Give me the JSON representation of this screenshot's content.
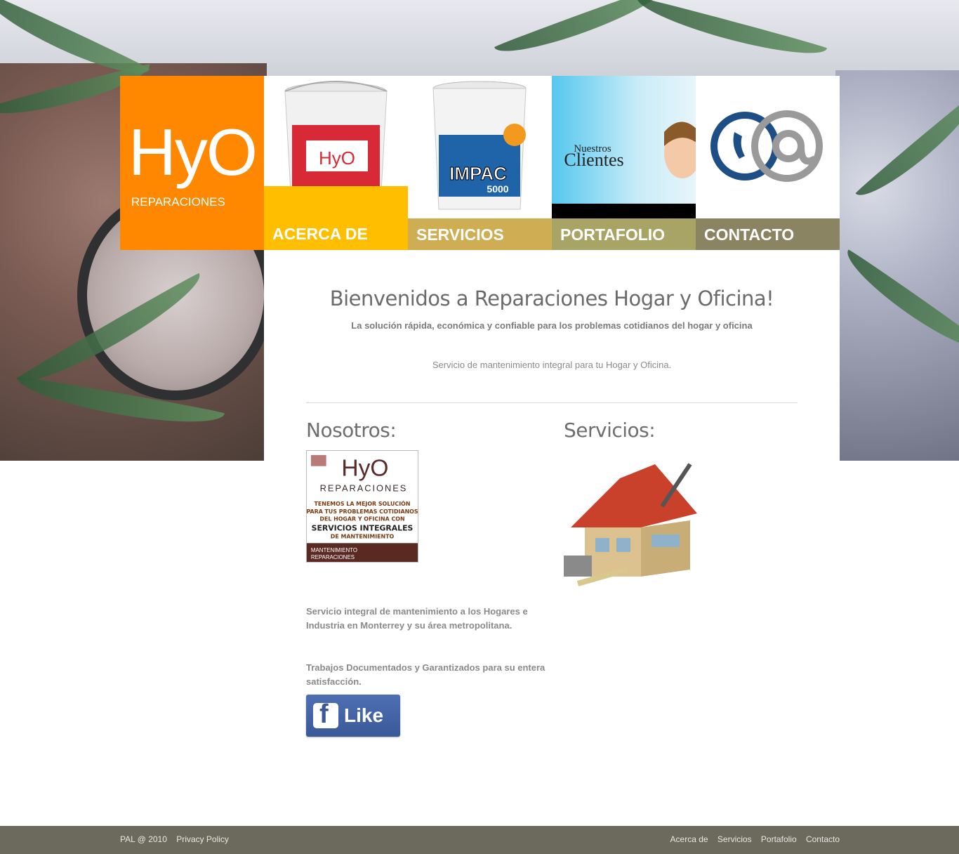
{
  "logo": {
    "title": "HyO",
    "subtitle": "REPARACIONES"
  },
  "nav": [
    {
      "label": "ACERCA DE"
    },
    {
      "label": "SERVICIOS"
    },
    {
      "label": "PORTAFOLIO"
    },
    {
      "label": "CONTACTO"
    }
  ],
  "tiles": {
    "bucket1": {
      "brand": "HyO"
    },
    "bucket2": {
      "brand": "IMPAC",
      "model": "5000"
    },
    "clients": {
      "line1": "Nuestros",
      "line2": "Clientes"
    },
    "contact": {
      "icon": "phone-at-icon"
    }
  },
  "main": {
    "welcome": "Bienvenidos a Reparaciones Hogar y Oficina!",
    "tagline": "La solución rápida, económica y confiable para los problemas cotidianos del hogar y oficina",
    "service_line": "Servicio de mantenimiento integral para tu Hogar y Oficina.",
    "nosotros_title": "Nosotros:",
    "servicios_title": "Servicios:",
    "about_card": {
      "brand": "HyO",
      "brand_sub": "REPARACIONES",
      "l1": "TENEMOS LA MEJOR SOLUCIÓN",
      "l2": "PARA TUS PROBLEMAS COTIDIANOS",
      "l3": "DEL HOGAR Y OFICINA CON",
      "l4": "SERVICIOS INTEGRALES",
      "l5": "DE MANTENIMIENTO",
      "b1": "MANTENIMIENTO",
      "b2": "REPARACIONES"
    },
    "para1": "Servicio integral de mantenimiento a los Hogares e Industria en Monterrey y su área metropolitana.",
    "para2": " Trabajos Documentados y Garantizados para su entera satisfacción.",
    "like_label": "Like"
  },
  "footer": {
    "copyright": "PAL @ 2010",
    "privacy": "Privacy Policy",
    "links": [
      "Acerca de",
      "Servicios",
      "Portafolio",
      "Contacto"
    ]
  },
  "colors": {
    "orange": "#ff8800",
    "yellow": "#ffbf00",
    "mustard": "#cfad52",
    "olive": "#a7a466",
    "taupe": "#8a8462",
    "footer": "#6b6a5d"
  }
}
